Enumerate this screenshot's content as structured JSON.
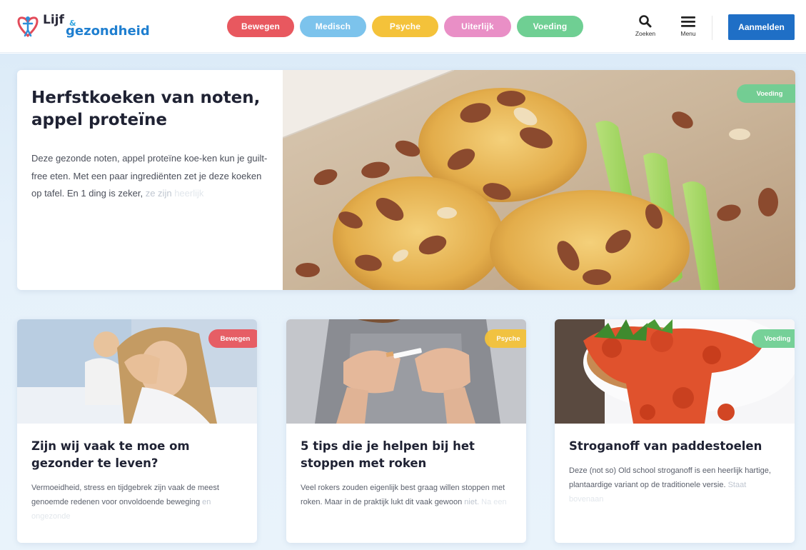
{
  "header": {
    "logo": {
      "line1": "Lijf",
      "amp": "&",
      "line2": "gezondheid"
    },
    "categories": [
      {
        "label": "Bewegen",
        "color": "#e8585f"
      },
      {
        "label": "Medisch",
        "color": "#7cc3ec"
      },
      {
        "label": "Psyche",
        "color": "#f4c23a"
      },
      {
        "label": "Uiterlijk",
        "color": "#e98fc6"
      },
      {
        "label": "Voeding",
        "color": "#6fcf93"
      }
    ],
    "search_label": "Zoeken",
    "menu_label": "Menu",
    "login_label": "Aanmelden",
    "login_color": "#1f6fc6"
  },
  "hero": {
    "title": "Herfstkoeken van noten, appel proteïne",
    "desc_main": "Deze gezonde noten, appel proteïne koe-ken kun je guilt-free eten. Met een paar ingrediënten zet je deze koeken op tafel. En 1 ding is zeker, ",
    "desc_fade": "ze zijn ",
    "desc_fade2": "heerlijk",
    "badge": "Voeding",
    "badge_color": "#6fcf93"
  },
  "articles": [
    {
      "title": "Zijn wij vaak te moe om gezonder te leven?",
      "desc_main": "Vermoeidheid, stress en tijdgebrek zijn vaak de meest genoemde redenen voor onvoldoende beweging ",
      "desc_fade": "en ",
      "desc_fade2": "ongezonde",
      "badge": "Bewegen",
      "badge_color": "#e8585f"
    },
    {
      "title": "5 tips die je helpen bij het stoppen met roken",
      "desc_main": "Veel rokers zouden eigenlijk best graag willen stoppen met roken. Maar in de praktijk lukt dit vaak gewoon ",
      "desc_fade": "niet. ",
      "desc_fade2": "Na een",
      "badge": "Psyche",
      "badge_color": "#f4c23a"
    },
    {
      "title": "Stroganoff van paddestoelen",
      "desc_main": "Deze (not so) Old school stroganoff is een heerlijk hartige, plantaardige variant op de traditionele versie. ",
      "desc_fade": "Staat ",
      "desc_fade2": "bovenaan",
      "badge": "Voeding",
      "badge_color": "#6fcf93"
    }
  ]
}
